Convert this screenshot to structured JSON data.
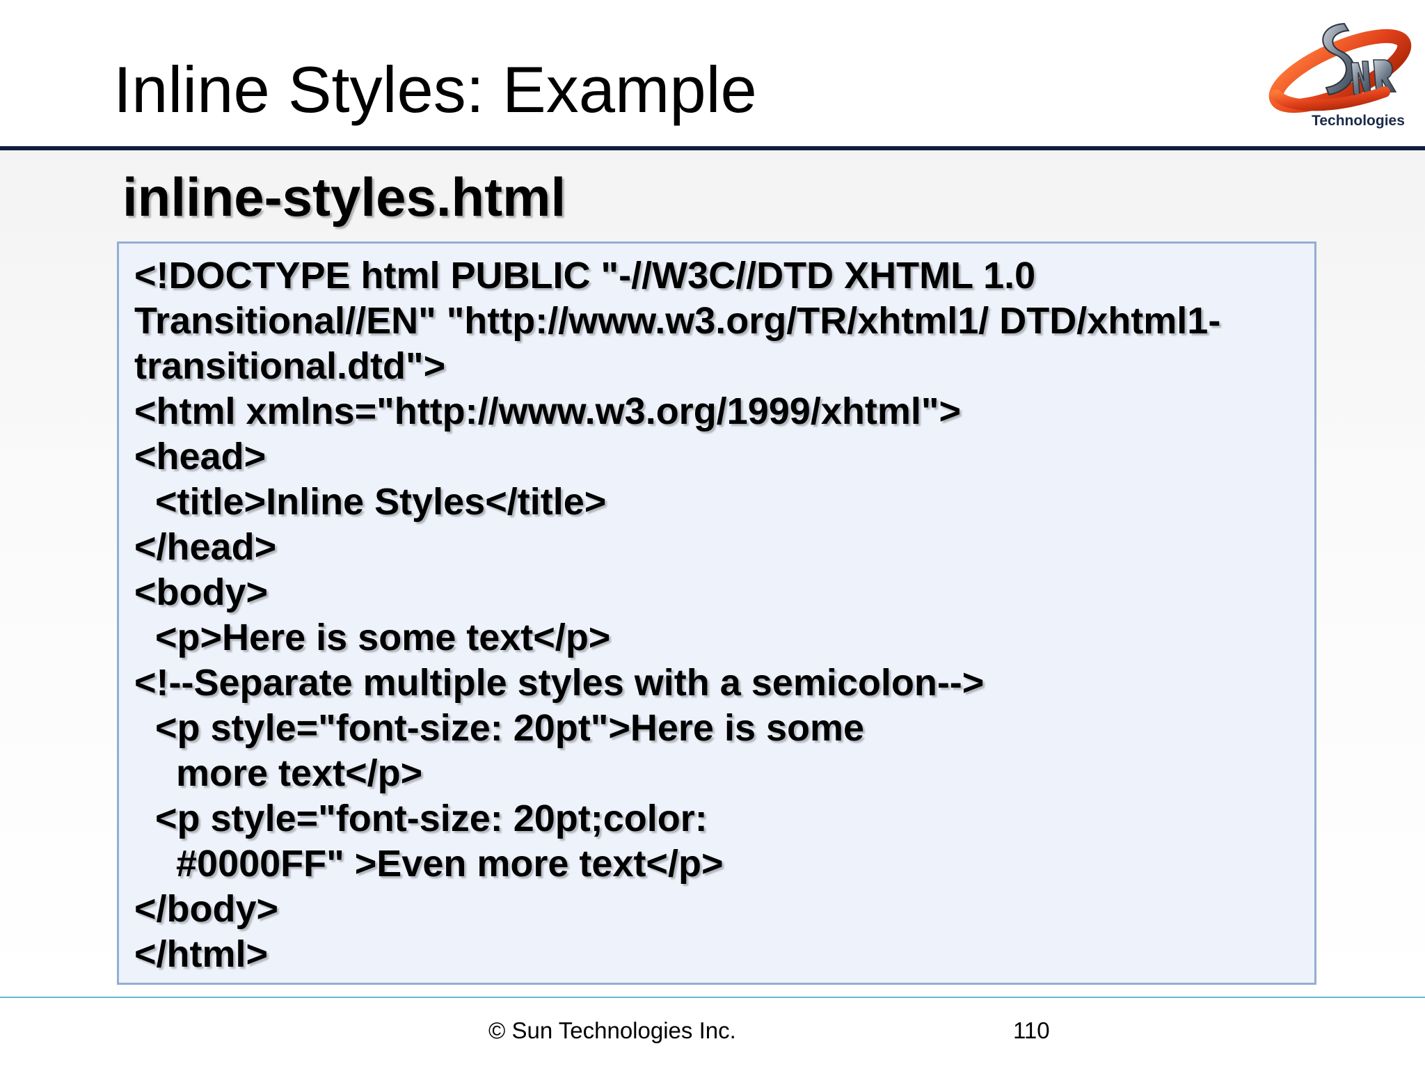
{
  "slide": {
    "title": "Inline Styles: Example",
    "file_heading": "inline-styles.html"
  },
  "logo": {
    "text": "Technologies",
    "icon": "sun-technologies-logo",
    "colors": {
      "ring": "#e0401a",
      "metal": "#6e7a88",
      "text": "#1a2a4a"
    }
  },
  "code": {
    "lines": [
      "<!DOCTYPE html PUBLIC \"-//W3C//DTD XHTML 1.0",
      "Transitional//EN\" \"http://www.w3.org/TR/xhtml1/ DTD/xhtml1-",
      "transitional.dtd\">",
      "<html xmlns=\"http://www.w3.org/1999/xhtml\">",
      "<head>",
      "  <title>Inline Styles</title>",
      "</head>",
      "<body>",
      "  <p>Here is some text</p>",
      "<!--Separate multiple styles with a semicolon-->",
      "  <p style=\"font-size: 20pt\">Here is some",
      "    more text</p>",
      "  <p style=\"font-size: 20pt;color:",
      "    #0000FF\" >Even more text</p>",
      "</body>",
      "</html>"
    ]
  },
  "footer": {
    "copyright": "© Sun Technologies Inc.",
    "page_number": "110"
  },
  "colors": {
    "title_rule": "#0f1d3f",
    "code_box_bg": "#edf2fb",
    "code_box_border": "#93aed3",
    "footer_rule": "#5fb9cf"
  }
}
